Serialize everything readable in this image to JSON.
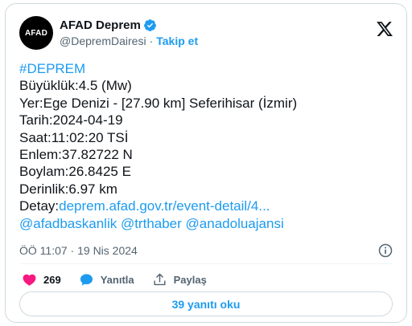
{
  "account": {
    "avatar_text": "AFAD",
    "name": "AFAD Deprem",
    "handle": "@DepremDairesi",
    "separator": "·",
    "follow_label": "Takip et"
  },
  "tweet": {
    "hashtag": "#DEPREM",
    "lines": [
      "Büyüklük:4.5 (Mw)",
      "Yer:Ege Denizi - [27.90 km] Seferihisar (İzmir)",
      "Tarih:2024-04-19",
      "Saat:11:02:20 TSİ",
      "Enlem:37.82722 N",
      "Boylam:26.8425 E",
      "Derinlik:6.97 km"
    ],
    "detail_prefix": "Detay:",
    "detail_link": "deprem.afad.gov.tr/event-detail/4...",
    "mentions": [
      "@afadbaskanlik",
      "@trthaber",
      "@anadoluajansi"
    ],
    "timestamp": "ÖÖ 11:07 · 19 Nis 2024"
  },
  "actions": {
    "like_count": "269",
    "reply_label": "Yanıtla",
    "share_label": "Paylaş"
  },
  "replies_button": "39 yanıtı oku",
  "icons": {
    "verified": "verified-badge-icon",
    "x_logo": "x-logo-icon",
    "info": "info-icon",
    "like": "heart-icon",
    "reply": "speech-bubble-icon",
    "share": "share-icon"
  },
  "colors": {
    "link": "#1d9bf0",
    "like": "#f91880",
    "text": "#0f1419",
    "muted": "#536471",
    "border": "#cfd9de"
  }
}
